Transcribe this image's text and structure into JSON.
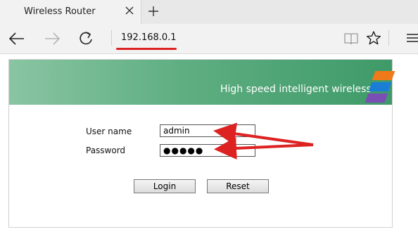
{
  "browser": {
    "tab_title": "Wireless Router",
    "address": "192.168.0.1",
    "icons": {
      "close": "close-icon",
      "new_tab": "plus-icon",
      "back": "back-arrow-icon",
      "forward": "forward-arrow-icon",
      "refresh": "refresh-icon",
      "reading_view": "book-icon",
      "favorites": "star-icon",
      "hub": "hamburger-icon"
    }
  },
  "router": {
    "banner_text": "High speed intelligent wireless",
    "stripe_colors": [
      "#f07a1a",
      "#1a7fd4",
      "#7a4fb5"
    ],
    "username_label": "User name",
    "username_value": "admin",
    "password_label": "Password",
    "password_value": "●●●●●",
    "login_label": "Login",
    "reset_label": "Reset"
  },
  "annotation": {
    "underline_color": "#dd2222",
    "arrow_color": "#dd2222"
  }
}
